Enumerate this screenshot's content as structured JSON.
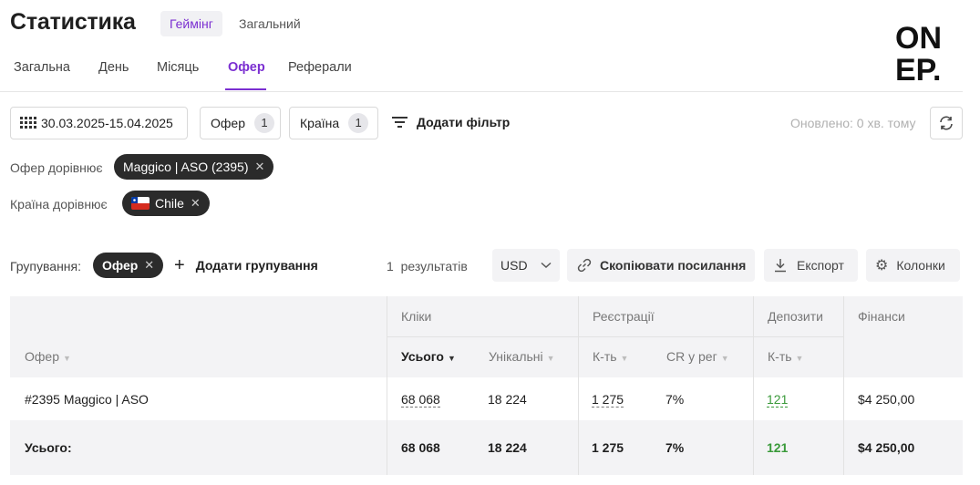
{
  "header": {
    "title": "Статистика",
    "segments": [
      "Геймінг",
      "Загальний"
    ],
    "logo_text": [
      "ON",
      "EP."
    ]
  },
  "tabs": [
    "Загальна",
    "День",
    "Місяць",
    "Офер",
    "Реферали"
  ],
  "filters": {
    "date_range": "30.03.2025-15.04.2025",
    "offer_label": "Офер",
    "offer_count": "1",
    "country_label": "Країна",
    "country_count": "1",
    "add_filter": "Додати фільтр",
    "updated": "Оновлено: 0 хв. тому"
  },
  "conditions": [
    {
      "label": "Офер дорівнює",
      "value": "Maggico | ASO (2395)"
    },
    {
      "label": "Країна дорівнює",
      "value": "Chile"
    }
  ],
  "grouping": {
    "label": "Групування:",
    "chip": "Офер",
    "add": "Додати групування",
    "results": "1  результатів",
    "currency": "USD",
    "copy_link": "Скопіювати посилання",
    "export": "Експорт",
    "columns": "Колонки"
  },
  "table": {
    "groups": [
      "Кліки",
      "Реєстрації",
      "Депозити",
      "Фінанси"
    ],
    "columns": [
      "Офер",
      "Усього",
      "Унікальні",
      "К-ть",
      "CR у рег",
      "К-ть"
    ],
    "rows": [
      {
        "offer": "#2395 Maggico | ASO",
        "total": "68 068",
        "unique": "18 224",
        "reg": "1 275",
        "cr": "7%",
        "dep": "121",
        "fin": "$4 250,00"
      }
    ],
    "totals": {
      "label": "Усього:",
      "total": "68 068",
      "unique": "18 224",
      "reg": "1 275",
      "cr": "7%",
      "dep": "121",
      "fin": "$4 250,00"
    }
  },
  "colors": {
    "accent": "#7b2fd1",
    "positive": "#3a9a3a",
    "chip_bg": "#2b2b2b"
  }
}
